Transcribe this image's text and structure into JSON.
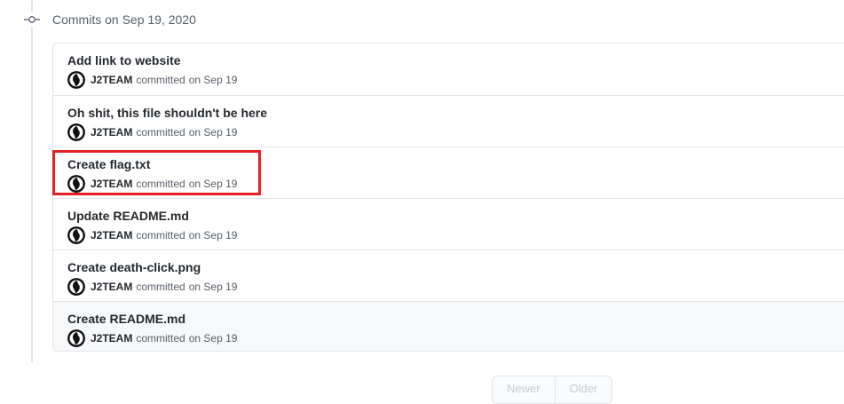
{
  "group": {
    "title": "Commits on Sep 19, 2020",
    "icon": "git-commit-icon"
  },
  "commits": [
    {
      "title": "Add link to website",
      "author": "J2TEAM",
      "verb": "committed",
      "date": "on Sep 19"
    },
    {
      "title": "Oh shit, this file shouldn't be here",
      "author": "J2TEAM",
      "verb": "committed",
      "date": "on Sep 19"
    },
    {
      "title": "Create flag.txt",
      "author": "J2TEAM",
      "verb": "committed",
      "date": "on Sep 19"
    },
    {
      "title": "Update README.md",
      "author": "J2TEAM",
      "verb": "committed",
      "date": "on Sep 19"
    },
    {
      "title": "Create death-click.png",
      "author": "J2TEAM",
      "verb": "committed",
      "date": "on Sep 19"
    },
    {
      "title": "Create README.md",
      "author": "J2TEAM",
      "verb": "committed",
      "date": "on Sep 19"
    }
  ],
  "pagination": {
    "newer_label": "Newer",
    "older_label": "Older"
  },
  "colors": {
    "highlight": "#e32227",
    "border": "#e1e4e8",
    "muted_text": "#586069",
    "text": "#24292e"
  }
}
